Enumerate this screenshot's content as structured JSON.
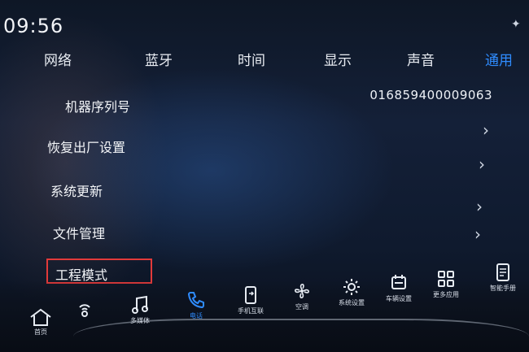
{
  "status": {
    "time": "09:56"
  },
  "tabs": [
    {
      "label": "网络"
    },
    {
      "label": "蓝牙"
    },
    {
      "label": "时间"
    },
    {
      "label": "显示"
    },
    {
      "label": "声音"
    },
    {
      "label": "通用",
      "active": true
    }
  ],
  "settings": {
    "serial": {
      "label": "机器序列号",
      "value": "016859400009063"
    },
    "items": [
      {
        "label": "恢复出厂设置"
      },
      {
        "label": "系统更新"
      },
      {
        "label": "文件管理"
      },
      {
        "label": "工程模式",
        "highlighted": true
      }
    ]
  },
  "dock": [
    {
      "label": "首页",
      "icon": "home-icon"
    },
    {
      "label": "",
      "icon": "voice-icon"
    },
    {
      "label": "多媒体",
      "icon": "music-icon"
    },
    {
      "label": "电话",
      "icon": "phone-icon",
      "active": true
    },
    {
      "label": "手机互联",
      "icon": "phone-link-icon"
    },
    {
      "label": "空调",
      "icon": "fan-icon"
    },
    {
      "label": "系统设置",
      "icon": "gear-icon"
    },
    {
      "label": "车辆设置",
      "icon": "car-settings-icon"
    },
    {
      "label": "更多应用",
      "icon": "apps-icon"
    },
    {
      "label": "智能手册",
      "icon": "manual-icon"
    }
  ],
  "colors": {
    "accent": "#2f8cff",
    "highlight_border": "#e23a3a",
    "text": "#f3f5f8"
  }
}
